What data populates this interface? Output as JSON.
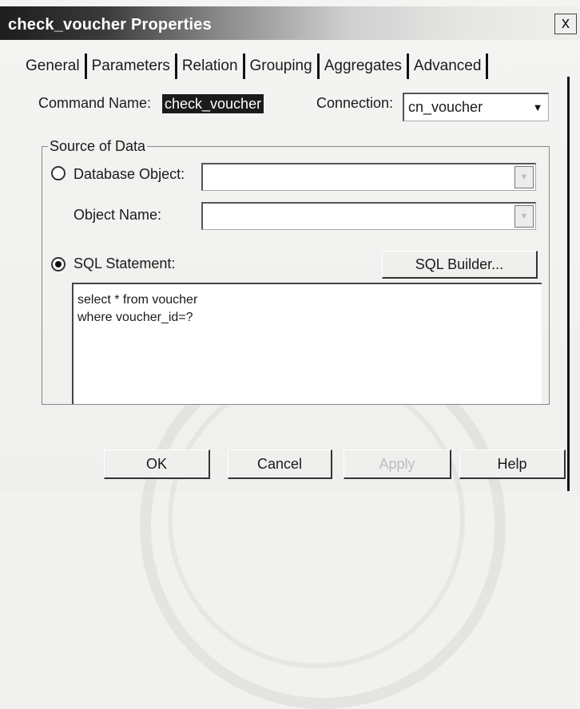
{
  "window": {
    "title": "check_voucher Properties",
    "close_label": "x"
  },
  "tabs": [
    {
      "label": "General",
      "selected": true
    },
    {
      "label": "Parameters"
    },
    {
      "label": "Relation"
    },
    {
      "label": "Grouping"
    },
    {
      "label": "Aggregates"
    },
    {
      "label": "Advanced"
    }
  ],
  "command": {
    "label": "Command Name:",
    "value": "check_voucher"
  },
  "connection": {
    "label": "Connection:",
    "value": "cn_voucher"
  },
  "source": {
    "group_label": "Source of Data",
    "database_object": {
      "label": "Database Object:",
      "value": "",
      "selected": false
    },
    "object_name": {
      "label": "Object Name:",
      "value": ""
    },
    "sql_statement": {
      "label": "SQL Statement:",
      "selected": true
    },
    "sql_builder_label": "SQL Builder...",
    "sql_text": "select * from voucher\nwhere voucher_id=?"
  },
  "buttons": {
    "ok": "OK",
    "cancel": "Cancel",
    "apply": "Apply",
    "help": "Help"
  }
}
